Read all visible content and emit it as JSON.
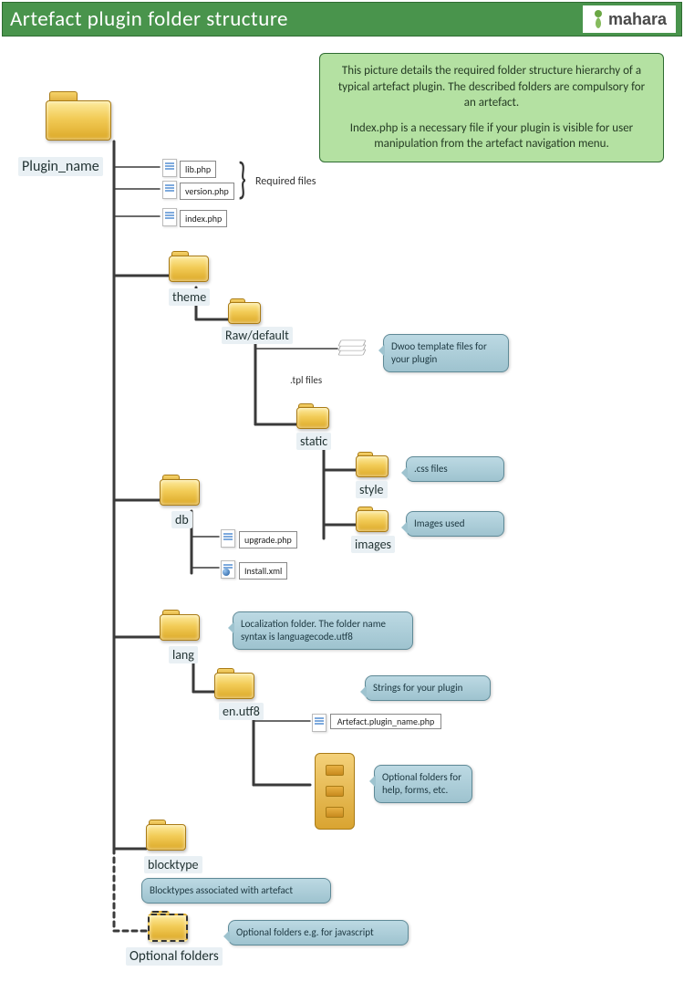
{
  "header": {
    "title": "Artefact plugin  folder structure",
    "logo_text": "mahara"
  },
  "info": {
    "p1": "This picture details the required folder structure hierarchy of a typical artefact plugin. The described folders are compulsory for an artefact.",
    "p2": "Index.php is a necessary file if your plugin is visible for user manipulation from the artefact navigation menu."
  },
  "labels": {
    "plugin_name": "Plugin_name",
    "required_files": "Required files",
    "lib_php": "lib.php",
    "version_php": "version.php",
    "index_php": "index.php",
    "theme": "theme",
    "raw_default": "Raw/default",
    "tpl_files": ".tpl files",
    "static": "static",
    "style": "style",
    "images": "images",
    "css_files": ".css files",
    "images_used": "Images used",
    "db": "db",
    "upgrade_php": "upgrade.php",
    "install_xml": "Install.xml",
    "lang": "lang",
    "en_utf8": "en.utf8",
    "artefact_php": "Artefact.plugin_name.php",
    "blocktype": "blocktype",
    "optional_folders": "Optional folders"
  },
  "callouts": {
    "dwoo": "Dwoo template files for your plugin",
    "localization": "Localization folder. The folder name syntax is languagecode.utf8",
    "strings": "Strings for your plugin",
    "optional_help": "Optional folders for help, forms, etc.",
    "blocktypes": "Blocktypes associated with artefact",
    "optional_js": "Optional folders e.g. for javascript"
  },
  "chart_data": {
    "type": "tree",
    "root": {
      "name": "Plugin_name",
      "kind": "folder",
      "children": [
        {
          "name": "lib.php",
          "kind": "file",
          "note": "Required files"
        },
        {
          "name": "version.php",
          "kind": "file",
          "note": "Required files"
        },
        {
          "name": "index.php",
          "kind": "file"
        },
        {
          "name": "theme",
          "kind": "folder",
          "children": [
            {
              "name": "Raw/default",
              "kind": "folder",
              "children": [
                {
                  "name": ".tpl files",
                  "kind": "files",
                  "note": "Dwoo template files for your plugin"
                },
                {
                  "name": "static",
                  "kind": "folder",
                  "children": [
                    {
                      "name": "style",
                      "kind": "folder",
                      "note": ".css files"
                    },
                    {
                      "name": "images",
                      "kind": "folder",
                      "note": "Images used"
                    }
                  ]
                }
              ]
            }
          ]
        },
        {
          "name": "db",
          "kind": "folder",
          "children": [
            {
              "name": "upgrade.php",
              "kind": "file"
            },
            {
              "name": "Install.xml",
              "kind": "file"
            }
          ]
        },
        {
          "name": "lang",
          "kind": "folder",
          "note": "Localization folder. The folder name syntax is languagecode.utf8",
          "children": [
            {
              "name": "en.utf8",
              "kind": "folder",
              "children": [
                {
                  "name": "Artefact.plugin_name.php",
                  "kind": "file",
                  "note": "Strings for your plugin"
                },
                {
                  "name": "(help/forms/etc.)",
                  "kind": "folders",
                  "note": "Optional folders for help, forms, etc."
                }
              ]
            }
          ]
        },
        {
          "name": "blocktype",
          "kind": "folder",
          "note": "Blocktypes associated with artefact"
        },
        {
          "name": "Optional folders",
          "kind": "folder",
          "optional": true,
          "note": "Optional folders e.g. for javascript"
        }
      ]
    }
  }
}
